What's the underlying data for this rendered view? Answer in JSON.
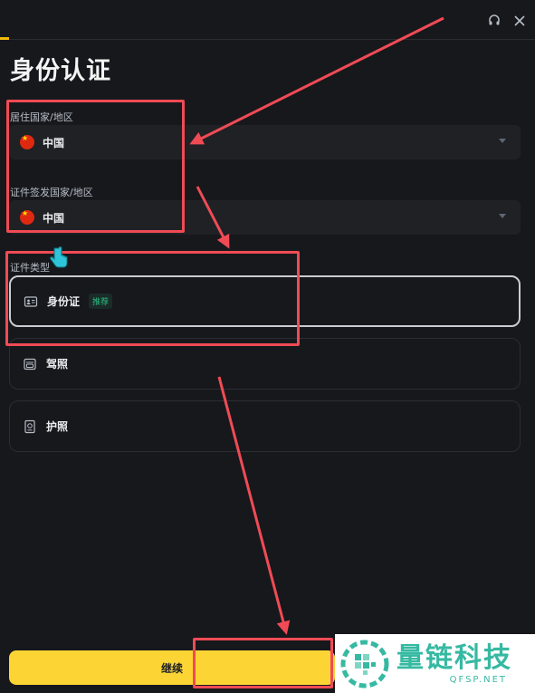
{
  "header": {
    "icons": [
      "headset-icon",
      "close-icon"
    ],
    "progress": 0.017
  },
  "page": {
    "title": "身份认证"
  },
  "residence": {
    "label": "居住国家/地区",
    "value": "中国"
  },
  "issuing": {
    "label": "证件签发国家/地区",
    "value": "中国"
  },
  "doc_type": {
    "label": "证件类型",
    "options": [
      {
        "label": "身份证",
        "badge": "推荐",
        "icon": "id-card-icon",
        "selected": true
      },
      {
        "label": "驾照",
        "icon": "driver-license-icon",
        "selected": false
      },
      {
        "label": "护照",
        "icon": "passport-icon",
        "selected": false
      }
    ]
  },
  "footer": {
    "continue_label": "继续"
  },
  "watermark": {
    "name": "量链科技",
    "domain": "QFSP.NET"
  },
  "colors": {
    "accent": "#fcd535",
    "annotation": "#f04b55",
    "badge": "#2ebd85",
    "watermark": "#36b9a2"
  }
}
